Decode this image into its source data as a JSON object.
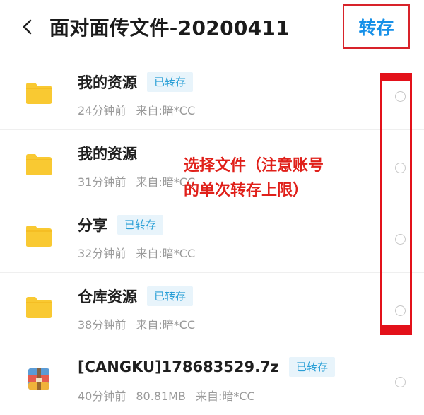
{
  "header": {
    "back_icon": "chevron-left-icon",
    "title": "面对面传文件-20200411",
    "save_label": "转存"
  },
  "annotation": {
    "line1": "选择文件（注意账号",
    "line2": "的单次转存上限）"
  },
  "colors": {
    "accent": "#1690e8",
    "badge_bg": "#e8f4fb",
    "badge_text": "#2a9fd6",
    "highlight_red": "#e3111a",
    "folder_yellow": "#f9c932"
  },
  "files": [
    {
      "icon": "folder-icon",
      "name": "我的资源",
      "badge": "已转存",
      "time": "24分钟前",
      "size": "",
      "source": "来自:暗*CC"
    },
    {
      "icon": "folder-icon",
      "name": "我的资源",
      "badge": "",
      "time": "31分钟前",
      "size": "",
      "source": "来自:暗*CC"
    },
    {
      "icon": "folder-icon",
      "name": "分享",
      "badge": "已转存",
      "time": "32分钟前",
      "size": "",
      "source": "来自:暗*CC"
    },
    {
      "icon": "folder-icon",
      "name": "仓库资源",
      "badge": "已转存",
      "time": "38分钟前",
      "size": "",
      "source": "来自:暗*CC"
    },
    {
      "icon": "archive-icon",
      "name": "[CANGKU]178683529.7z",
      "badge": "已转存",
      "time": "40分钟前",
      "size": "80.81MB",
      "source": "来自:暗*CC"
    }
  ]
}
